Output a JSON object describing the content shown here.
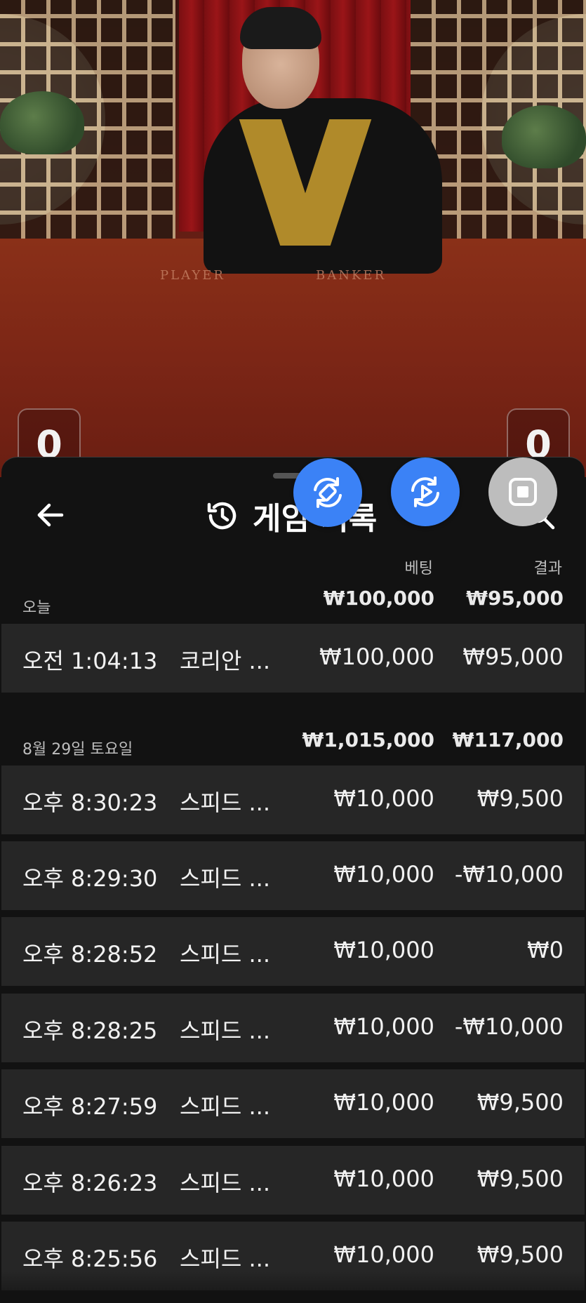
{
  "sheet": {
    "title": "게임 기록",
    "columns": {
      "bet": "베팅",
      "result": "결과"
    }
  },
  "video": {
    "table_player_label": "PLAYER",
    "table_banker_label": "BANKER",
    "player_score": "0",
    "banker_score": "0"
  },
  "groups": [
    {
      "date": "오늘",
      "total_bet": "₩100,000",
      "total_result": "₩95,000",
      "rows": [
        {
          "time": "오전 1:04:13",
          "game": "코리안 ...",
          "bet": "₩100,000",
          "result": "₩95,000"
        }
      ]
    },
    {
      "date": "8월 29일 토요일",
      "total_bet": "₩1,015,000",
      "total_result": "₩117,000",
      "rows": [
        {
          "time": "오후 8:30:23",
          "game": "스피드 ...",
          "bet": "₩10,000",
          "result": "₩9,500"
        },
        {
          "time": "오후 8:29:30",
          "game": "스피드 ...",
          "bet": "₩10,000",
          "result": "-₩10,000"
        },
        {
          "time": "오후 8:28:52",
          "game": "스피드 ...",
          "bet": "₩10,000",
          "result": "₩0"
        },
        {
          "time": "오후 8:28:25",
          "game": "스피드 ...",
          "bet": "₩10,000",
          "result": "-₩10,000"
        },
        {
          "time": "오후 8:27:59",
          "game": "스피드 ...",
          "bet": "₩10,000",
          "result": "₩9,500"
        },
        {
          "time": "오후 8:26:23",
          "game": "스피드 ...",
          "bet": "₩10,000",
          "result": "₩9,500"
        },
        {
          "time": "오후 8:25:56",
          "game": "스피드 ...",
          "bet": "₩10,000",
          "result": "₩9,500"
        }
      ]
    }
  ],
  "icons": {
    "back": "arrow-left-icon",
    "history": "history-icon",
    "search": "search-icon",
    "fab1": "rotate-screen-icon",
    "fab2": "replay-video-icon",
    "fab3": "stop-icon"
  },
  "colors": {
    "fab_blue": "#3b82f6",
    "fab_gray": "#bdbdbd",
    "sheet_bg": "#121212",
    "row_bg": "#262626"
  }
}
